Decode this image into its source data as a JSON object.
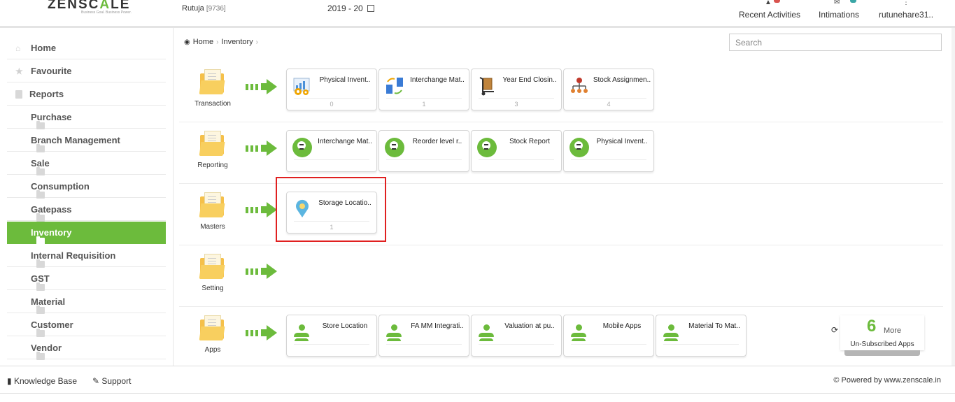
{
  "header": {
    "logo": {
      "part1": "ZENSC",
      "part2": "A",
      "part3": "LE",
      "tagline": "Business Goal. Business Power."
    },
    "user_name": "Rutuja",
    "user_id": "[9736]",
    "fiscal_year": "2019 - 20",
    "recent_activities": "Recent Activities",
    "intimations": "Intimations",
    "account": "rutunehare31.."
  },
  "sidebar": {
    "items": [
      {
        "label": "Home",
        "icon": "home-icon"
      },
      {
        "label": "Favourite",
        "icon": "star-icon"
      },
      {
        "label": "Reports",
        "icon": "file-icon"
      },
      {
        "label": "Purchase",
        "icon": "folder-icon"
      },
      {
        "label": "Branch Management",
        "icon": "folder-icon"
      },
      {
        "label": "Sale",
        "icon": "folder-icon"
      },
      {
        "label": "Consumption",
        "icon": "folder-icon"
      },
      {
        "label": "Gatepass",
        "icon": "folder-icon"
      },
      {
        "label": "Inventory",
        "icon": "folder-icon"
      },
      {
        "label": "Internal Requisition",
        "icon": "folder-icon"
      },
      {
        "label": "GST",
        "icon": "folder-icon"
      },
      {
        "label": "Material",
        "icon": "folder-icon"
      },
      {
        "label": "Customer",
        "icon": "folder-icon"
      },
      {
        "label": "Vendor",
        "icon": "folder-icon"
      }
    ],
    "active": "Inventory"
  },
  "breadcrumb": {
    "home": "Home",
    "current": "Inventory"
  },
  "search": {
    "placeholder": "Search"
  },
  "rows": [
    {
      "label": "Transaction",
      "tiles": [
        {
          "title": "Physical Invent..",
          "count": "0"
        },
        {
          "title": "Interchange Mat..",
          "count": "1"
        },
        {
          "title": "Year End Closin..",
          "count": "3"
        },
        {
          "title": "Stock Assignmen..",
          "count": "4"
        }
      ]
    },
    {
      "label": "Reporting",
      "tiles": [
        {
          "title": "Interchange Mat.."
        },
        {
          "title": "Reorder level r.."
        },
        {
          "title": "Stock Report"
        },
        {
          "title": "Physical Invent.."
        }
      ]
    },
    {
      "label": "Masters",
      "tiles": [
        {
          "title": "Storage Locatio..",
          "count": "1"
        }
      ]
    },
    {
      "label": "Setting",
      "tiles": []
    },
    {
      "label": "Apps",
      "tiles": [
        {
          "title": "Store Location"
        },
        {
          "title": "FA MM Integrati.."
        },
        {
          "title": "Valuation at pu.."
        },
        {
          "title": "Mobile Apps"
        },
        {
          "title": "Material To Mat.."
        }
      ]
    }
  ],
  "more_apps": {
    "count": "6",
    "more": "More",
    "label": "Un-Subscribed Apps"
  },
  "footer": {
    "knowledge_base": "Knowledge Base",
    "support": "Support",
    "powered_by": "© Powered by www.zenscale.in"
  },
  "colors": {
    "accent": "#6cbb3c",
    "highlight": "#e02020",
    "folder": "#f5c04a"
  }
}
